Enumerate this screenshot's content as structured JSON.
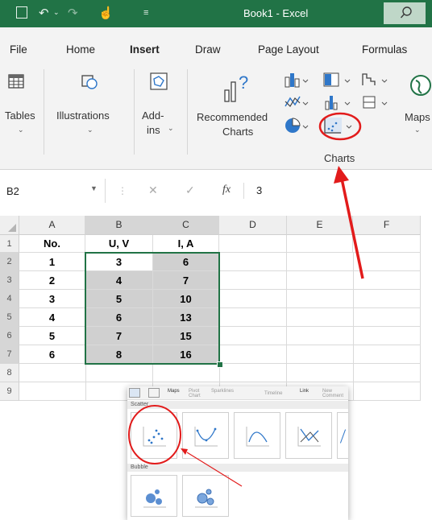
{
  "titlebar": {
    "title": "Book1  -  Excel"
  },
  "tabs": [
    "File",
    "Home",
    "Insert",
    "Draw",
    "Page Layout",
    "Formulas"
  ],
  "ribbon": {
    "tables": "Tables",
    "illustrations": "Illustrations",
    "addins_1": "Add-",
    "addins_2": "ins",
    "recommended_1": "Recommended",
    "recommended_2": "Charts",
    "maps": "Maps",
    "group_label": "Charts"
  },
  "formula_bar": {
    "cell_ref": "B2",
    "fx": "fx",
    "value": "3"
  },
  "columns": [
    "A",
    "B",
    "C",
    "D",
    "E",
    "F"
  ],
  "rows": [
    "1",
    "2",
    "3",
    "4",
    "5",
    "6",
    "7",
    "8",
    "9"
  ],
  "table": {
    "headers": [
      "No.",
      "U, V",
      "I, A"
    ],
    "rows": [
      [
        "1",
        "3",
        "6"
      ],
      [
        "2",
        "4",
        "7"
      ],
      [
        "3",
        "5",
        "10"
      ],
      [
        "4",
        "6",
        "13"
      ],
      [
        "5",
        "7",
        "15"
      ],
      [
        "6",
        "8",
        "16"
      ]
    ]
  },
  "gallery": {
    "toolbar": [
      "Maps",
      "Pivot Chart",
      "Sparklines",
      "Timeline",
      "Link",
      "New Comment"
    ],
    "scatter_label": "Scatter",
    "bubble_label": "Bubble"
  },
  "colors": {
    "excel_green": "#217346",
    "highlight_red": "#e21b1b",
    "selection_gray": "#d0d0d0"
  }
}
